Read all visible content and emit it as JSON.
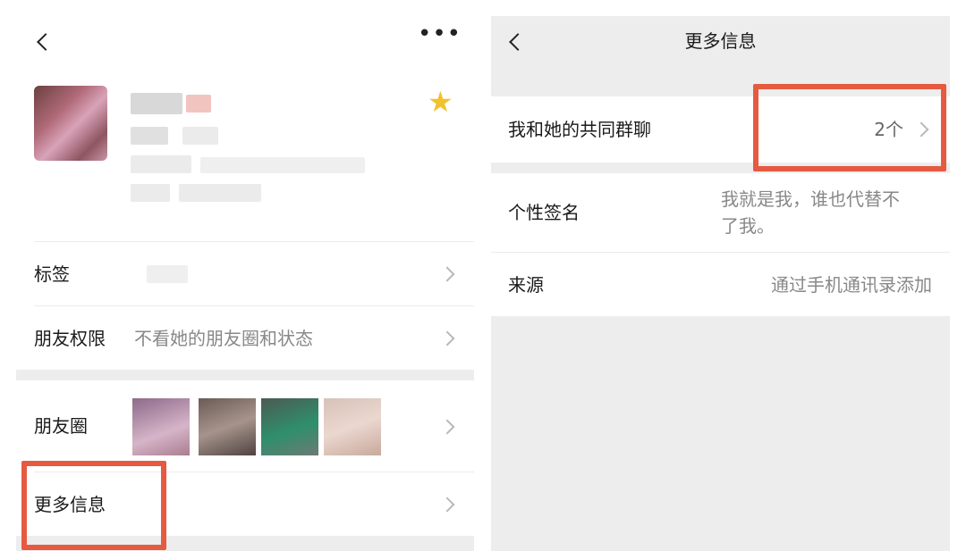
{
  "left": {
    "friend_tag_value": "",
    "rows": {
      "tags_label": "标签",
      "permissions_label": "朋友权限",
      "permissions_value": "不看她的朋友圈和状态",
      "moments_label": "朋友圈",
      "more_info_label": "更多信息"
    }
  },
  "right": {
    "title": "更多信息",
    "common_groups_label": "我和她的共同群聊",
    "common_groups_value": "2个",
    "signature_label": "个性签名",
    "signature_value_line1": "我就是我，谁也代替不",
    "signature_value_line2": "了我。",
    "source_label": "来源",
    "source_value": "通过手机通讯录添加"
  },
  "colors": {
    "highlight_box": "#e55a40",
    "star": "#f2c12e",
    "secondary_text": "#888888",
    "gray_background": "#ededed"
  },
  "icons": [
    "back-arrow-icon",
    "more-dots-icon",
    "star-icon",
    "chevron-right-icon"
  ]
}
